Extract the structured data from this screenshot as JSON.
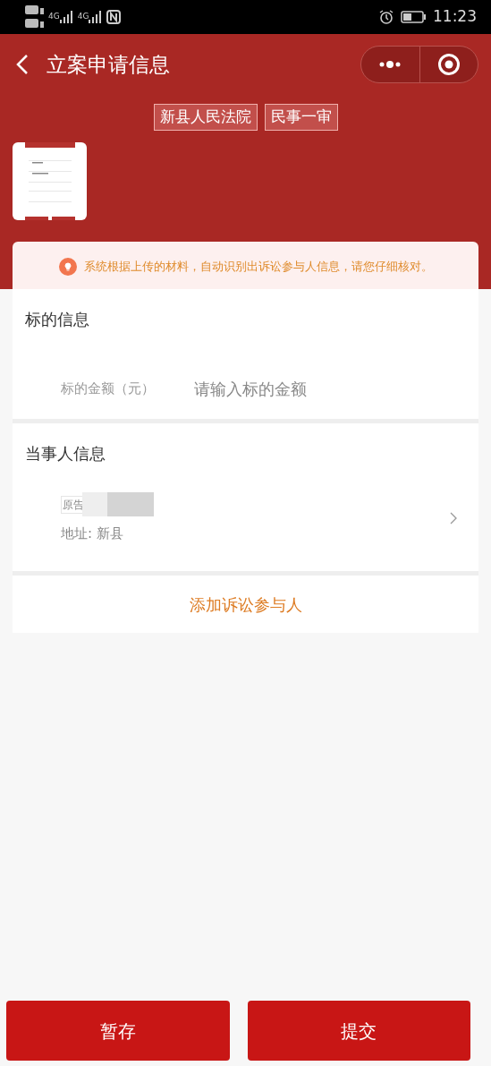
{
  "status_bar": {
    "time": "11:23",
    "network_labels": [
      "4G",
      "4G"
    ]
  },
  "nav": {
    "title": "立案申请信息"
  },
  "tags": [
    "新县人民法院",
    "民事一审"
  ],
  "notice": "系统根据上传的材料，自动识别出诉讼参与人信息，请您仔细核对。",
  "subject": {
    "title": "标的信息",
    "fields": [
      {
        "label": "标的金额（元）",
        "placeholder": "请输入标的金额"
      }
    ]
  },
  "parties": {
    "title": "当事人信息",
    "items": [
      {
        "role": "原告",
        "address": "地址: 新县"
      }
    ]
  },
  "add_button": "添加诉讼参与人",
  "buttons": [
    "暂存",
    "提交"
  ]
}
